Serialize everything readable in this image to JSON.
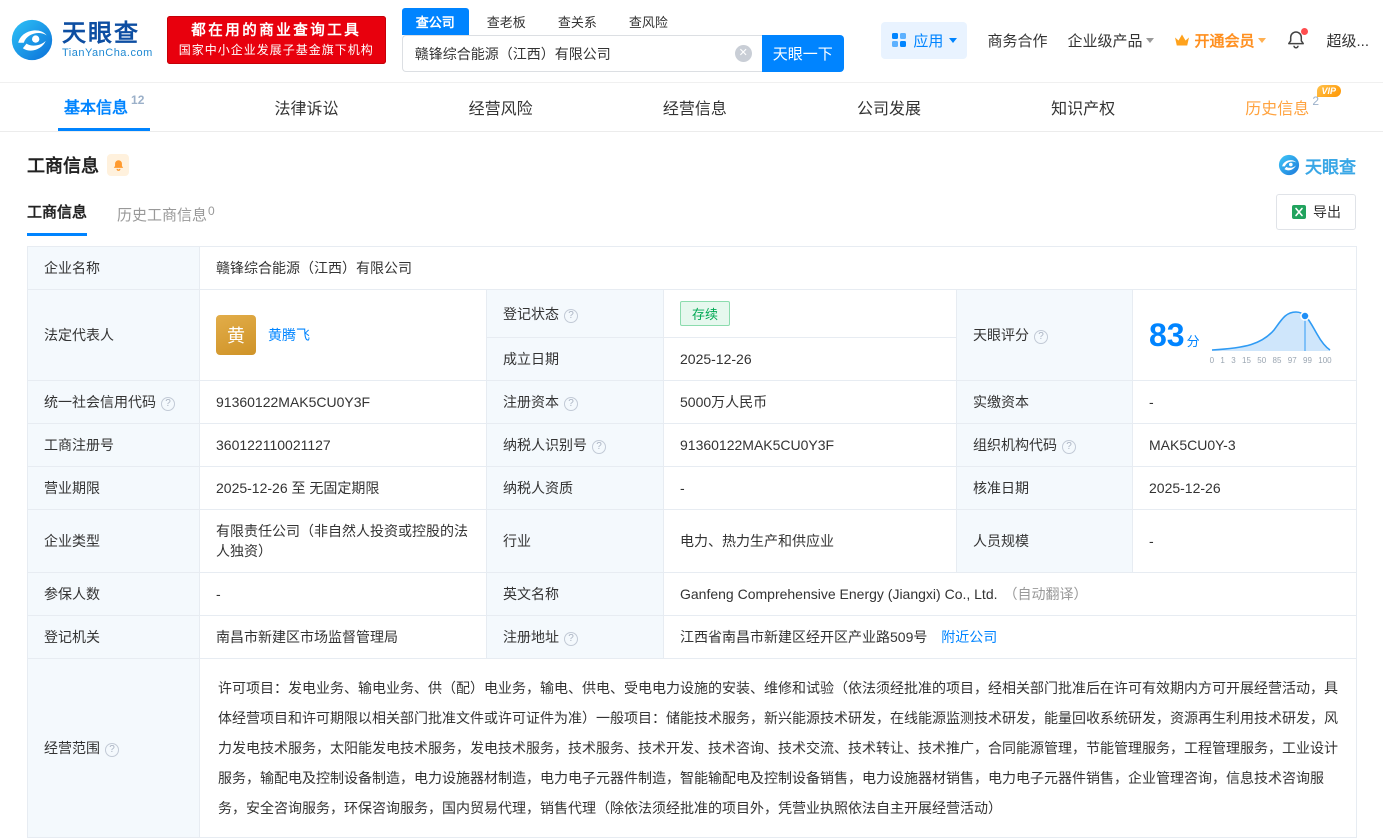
{
  "header": {
    "logo": {
      "brand": "天眼查",
      "domain": "TianYanCha.com"
    },
    "badge": {
      "line1": "都在用的商业查询工具",
      "line2": "国家中小企业发展子基金旗下机构"
    },
    "search_tabs": [
      {
        "label": "查公司"
      },
      {
        "label": "查老板"
      },
      {
        "label": "查关系"
      },
      {
        "label": "查风险"
      }
    ],
    "search": {
      "value": "赣锋综合能源（江西）有限公司",
      "button": "天眼一下"
    },
    "apps": "应用",
    "nav": [
      {
        "label": "商务合作"
      },
      {
        "label": "企业级产品"
      },
      {
        "label": "开通会员"
      },
      {
        "label": "超级..."
      }
    ]
  },
  "tabs": [
    {
      "label": "基本信息",
      "count": "12"
    },
    {
      "label": "法律诉讼"
    },
    {
      "label": "经营风险"
    },
    {
      "label": "经营信息"
    },
    {
      "label": "公司发展"
    },
    {
      "label": "知识产权"
    },
    {
      "label": "历史信息",
      "count": "2",
      "vip": "VIP"
    }
  ],
  "section": {
    "title": "工商信息",
    "brand": "天眼查",
    "subtabs": [
      {
        "label": "工商信息"
      },
      {
        "label": "历史工商信息",
        "count": "0"
      }
    ],
    "export": "导出"
  },
  "fields": {
    "company_name": {
      "label": "企业名称",
      "value": "赣锋综合能源（江西）有限公司"
    },
    "legal_rep": {
      "label": "法定代表人",
      "avatar": "黄",
      "name": "黄腾飞"
    },
    "reg_status": {
      "label": "登记状态",
      "value": "存续"
    },
    "establish_date": {
      "label": "成立日期",
      "value": "2025-12-26"
    },
    "score": {
      "label": "天眼评分",
      "value": "83",
      "unit": "分",
      "axis": [
        "0",
        "1",
        "3",
        "15",
        "50",
        "85",
        "97",
        "99",
        "100"
      ]
    },
    "credit_code": {
      "label": "统一社会信用代码",
      "value": "91360122MAK5CU0Y3F"
    },
    "reg_capital": {
      "label": "注册资本",
      "value": "5000万人民币"
    },
    "paid_capital": {
      "label": "实缴资本",
      "value": "-"
    },
    "reg_number": {
      "label": "工商注册号",
      "value": "360122110021127"
    },
    "taxpayer_id": {
      "label": "纳税人识别号",
      "value": "91360122MAK5CU0Y3F"
    },
    "org_code": {
      "label": "组织机构代码",
      "value": "MAK5CU0Y-3"
    },
    "business_term": {
      "label": "营业期限",
      "value": "2025-12-26 至 无固定期限"
    },
    "taxpayer_quality": {
      "label": "纳税人资质",
      "value": "-"
    },
    "approval_date": {
      "label": "核准日期",
      "value": "2025-12-26"
    },
    "company_type": {
      "label": "企业类型",
      "value": "有限责任公司（非自然人投资或控股的法人独资）"
    },
    "industry": {
      "label": "行业",
      "value": "电力、热力生产和供应业"
    },
    "staff_size": {
      "label": "人员规模",
      "value": "-"
    },
    "insured_count": {
      "label": "参保人数",
      "value": "-"
    },
    "english_name": {
      "label": "英文名称",
      "value": "Ganfeng Comprehensive Energy (Jiangxi) Co., Ltd.",
      "note": "（自动翻译）"
    },
    "reg_authority": {
      "label": "登记机关",
      "value": "南昌市新建区市场监督管理局"
    },
    "reg_address": {
      "label": "注册地址",
      "value": "江西省南昌市新建区经开区产业路509号",
      "link": "附近公司"
    },
    "business_scope": {
      "label": "经营范围",
      "value": "许可项目：发电业务、输电业务、供（配）电业务，输电、供电、受电电力设施的安装、维修和试验（依法须经批准的项目，经相关部门批准后在许可有效期内方可开展经营活动，具体经营项目和许可期限以相关部门批准文件或许可证件为准）一般项目：储能技术服务，新兴能源技术研发，在线能源监测技术研发，能量回收系统研发，资源再生利用技术研发，风力发电技术服务，太阳能发电技术服务，发电技术服务，技术服务、技术开发、技术咨询、技术交流、技术转让、技术推广，合同能源管理，节能管理服务，工程管理服务，工业设计服务，输配电及控制设备制造，电力设施器材制造，电力电子元器件制造，智能输配电及控制设备销售，电力设施器材销售，电力电子元器件销售，企业管理咨询，信息技术咨询服务，安全咨询服务，环保咨询服务，国内贸易代理，销售代理（除依法须经批准的项目外，凭营业执照依法自主开展经营活动）"
    }
  },
  "colors": {
    "accent_blue": "#0084ff",
    "vip_orange": "#ff8f1f",
    "status_green": "#00a854",
    "badge_red": "#e8000d",
    "avatar_gold": "#d8a13c"
  }
}
